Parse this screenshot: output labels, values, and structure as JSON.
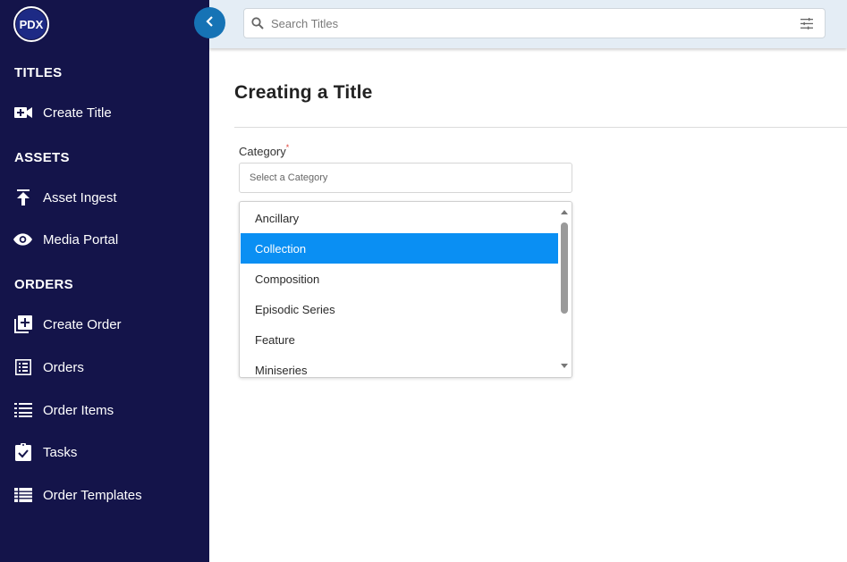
{
  "brand": {
    "logo_text": "PDX"
  },
  "sidebar": {
    "sections": {
      "titles": "TITLES",
      "assets": "ASSETS",
      "orders": "ORDERS"
    },
    "items": {
      "create_title": "Create Title",
      "asset_ingest": "Asset Ingest",
      "media_portal": "Media Portal",
      "create_order": "Create Order",
      "orders": "Orders",
      "order_items": "Order Items",
      "tasks": "Tasks",
      "order_templates": "Order Templates"
    }
  },
  "topbar": {
    "search_placeholder": "Search Titles"
  },
  "main": {
    "title": "Creating a Title",
    "category_label": "Category",
    "required_mark": "*",
    "category_placeholder": "Select a Category",
    "options": [
      "Ancillary",
      "Collection",
      "Composition",
      "Episodic Series",
      "Feature",
      "Miniseries"
    ],
    "selected_option": "Collection"
  },
  "colors": {
    "sidebar_bg": "#14144a",
    "accent": "#1673b5",
    "selected_option_bg": "#0a8ff3",
    "topbar_bg": "#e4edf5"
  }
}
